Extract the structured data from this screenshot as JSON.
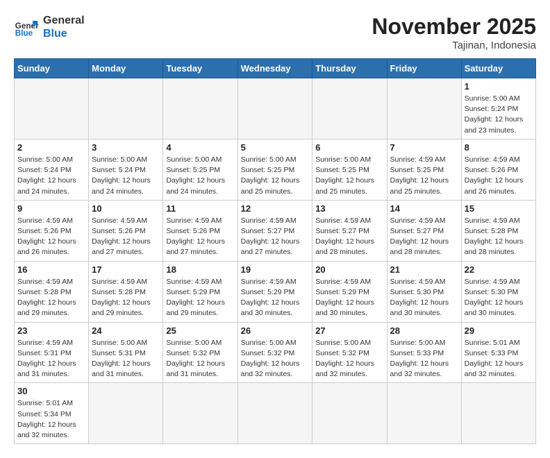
{
  "header": {
    "logo_general": "General",
    "logo_blue": "Blue",
    "month_title": "November 2025",
    "location": "Tajinan, Indonesia"
  },
  "days_of_week": [
    "Sunday",
    "Monday",
    "Tuesday",
    "Wednesday",
    "Thursday",
    "Friday",
    "Saturday"
  ],
  "weeks": [
    [
      {
        "day": "",
        "empty": true
      },
      {
        "day": "",
        "empty": true
      },
      {
        "day": "",
        "empty": true
      },
      {
        "day": "",
        "empty": true
      },
      {
        "day": "",
        "empty": true
      },
      {
        "day": "",
        "empty": true
      },
      {
        "day": "1",
        "sunrise": "5:00 AM",
        "sunset": "5:24 PM",
        "daylight": "12 hours and 23 minutes."
      }
    ],
    [
      {
        "day": "2",
        "sunrise": "5:00 AM",
        "sunset": "5:24 PM",
        "daylight": "12 hours and 24 minutes."
      },
      {
        "day": "3",
        "sunrise": "5:00 AM",
        "sunset": "5:24 PM",
        "daylight": "12 hours and 24 minutes."
      },
      {
        "day": "4",
        "sunrise": "5:00 AM",
        "sunset": "5:25 PM",
        "daylight": "12 hours and 24 minutes."
      },
      {
        "day": "5",
        "sunrise": "5:00 AM",
        "sunset": "5:25 PM",
        "daylight": "12 hours and 25 minutes."
      },
      {
        "day": "6",
        "sunrise": "5:00 AM",
        "sunset": "5:25 PM",
        "daylight": "12 hours and 25 minutes."
      },
      {
        "day": "7",
        "sunrise": "4:59 AM",
        "sunset": "5:25 PM",
        "daylight": "12 hours and 25 minutes."
      },
      {
        "day": "8",
        "sunrise": "4:59 AM",
        "sunset": "5:26 PM",
        "daylight": "12 hours and 26 minutes."
      }
    ],
    [
      {
        "day": "9",
        "sunrise": "4:59 AM",
        "sunset": "5:26 PM",
        "daylight": "12 hours and 26 minutes."
      },
      {
        "day": "10",
        "sunrise": "4:59 AM",
        "sunset": "5:26 PM",
        "daylight": "12 hours and 27 minutes."
      },
      {
        "day": "11",
        "sunrise": "4:59 AM",
        "sunset": "5:26 PM",
        "daylight": "12 hours and 27 minutes."
      },
      {
        "day": "12",
        "sunrise": "4:59 AM",
        "sunset": "5:27 PM",
        "daylight": "12 hours and 27 minutes."
      },
      {
        "day": "13",
        "sunrise": "4:59 AM",
        "sunset": "5:27 PM",
        "daylight": "12 hours and 28 minutes."
      },
      {
        "day": "14",
        "sunrise": "4:59 AM",
        "sunset": "5:27 PM",
        "daylight": "12 hours and 28 minutes."
      },
      {
        "day": "15",
        "sunrise": "4:59 AM",
        "sunset": "5:28 PM",
        "daylight": "12 hours and 28 minutes."
      }
    ],
    [
      {
        "day": "16",
        "sunrise": "4:59 AM",
        "sunset": "5:28 PM",
        "daylight": "12 hours and 29 minutes."
      },
      {
        "day": "17",
        "sunrise": "4:59 AM",
        "sunset": "5:28 PM",
        "daylight": "12 hours and 29 minutes."
      },
      {
        "day": "18",
        "sunrise": "4:59 AM",
        "sunset": "5:29 PM",
        "daylight": "12 hours and 29 minutes."
      },
      {
        "day": "19",
        "sunrise": "4:59 AM",
        "sunset": "5:29 PM",
        "daylight": "12 hours and 30 minutes."
      },
      {
        "day": "20",
        "sunrise": "4:59 AM",
        "sunset": "5:29 PM",
        "daylight": "12 hours and 30 minutes."
      },
      {
        "day": "21",
        "sunrise": "4:59 AM",
        "sunset": "5:30 PM",
        "daylight": "12 hours and 30 minutes."
      },
      {
        "day": "22",
        "sunrise": "4:59 AM",
        "sunset": "5:30 PM",
        "daylight": "12 hours and 30 minutes."
      }
    ],
    [
      {
        "day": "23",
        "sunrise": "4:59 AM",
        "sunset": "5:31 PM",
        "daylight": "12 hours and 31 minutes."
      },
      {
        "day": "24",
        "sunrise": "5:00 AM",
        "sunset": "5:31 PM",
        "daylight": "12 hours and 31 minutes."
      },
      {
        "day": "25",
        "sunrise": "5:00 AM",
        "sunset": "5:32 PM",
        "daylight": "12 hours and 31 minutes."
      },
      {
        "day": "26",
        "sunrise": "5:00 AM",
        "sunset": "5:32 PM",
        "daylight": "12 hours and 32 minutes."
      },
      {
        "day": "27",
        "sunrise": "5:00 AM",
        "sunset": "5:32 PM",
        "daylight": "12 hours and 32 minutes."
      },
      {
        "day": "28",
        "sunrise": "5:00 AM",
        "sunset": "5:33 PM",
        "daylight": "12 hours and 32 minutes."
      },
      {
        "day": "29",
        "sunrise": "5:01 AM",
        "sunset": "5:33 PM",
        "daylight": "12 hours and 32 minutes."
      }
    ],
    [
      {
        "day": "30",
        "sunrise": "5:01 AM",
        "sunset": "5:34 PM",
        "daylight": "12 hours and 32 minutes."
      },
      {
        "day": "",
        "empty": true
      },
      {
        "day": "",
        "empty": true
      },
      {
        "day": "",
        "empty": true
      },
      {
        "day": "",
        "empty": true
      },
      {
        "day": "",
        "empty": true
      },
      {
        "day": "",
        "empty": true
      }
    ]
  ]
}
